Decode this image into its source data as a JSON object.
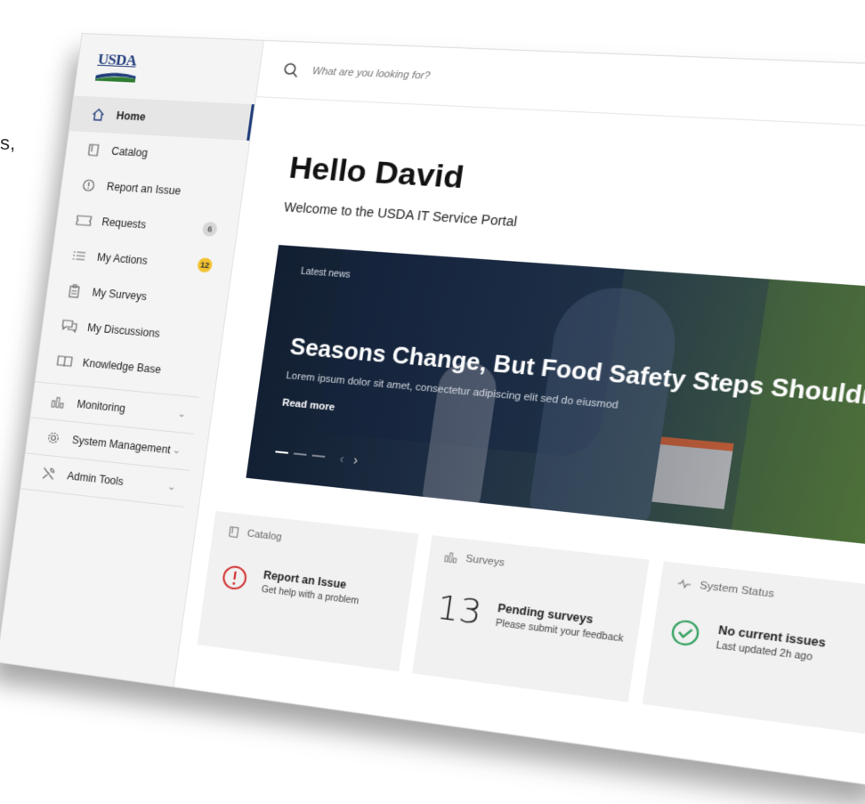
{
  "stray_text": "s,",
  "brand": {
    "logo_text": "USDA"
  },
  "search": {
    "placeholder": "What are you looking for?"
  },
  "sidebar": {
    "items": [
      {
        "label": "Home",
        "icon": "home-icon",
        "active": true
      },
      {
        "label": "Catalog",
        "icon": "book-icon"
      },
      {
        "label": "Report an Issue",
        "icon": "alert-circle-icon"
      },
      {
        "label": "Requests",
        "icon": "ticket-icon",
        "badge": "6"
      },
      {
        "label": "My Actions",
        "icon": "list-icon",
        "badge": "12"
      },
      {
        "label": "My Surveys",
        "icon": "clipboard-icon"
      },
      {
        "label": "My Discussions",
        "icon": "chat-icon"
      },
      {
        "label": "Knowledge Base",
        "icon": "open-book-icon"
      }
    ],
    "groups": [
      {
        "label": "Monitoring",
        "icon": "bar-chart-icon"
      },
      {
        "label": "System Management",
        "icon": "gear-icon"
      },
      {
        "label": "Admin Tools",
        "icon": "tools-icon"
      }
    ]
  },
  "greeting": {
    "title": "Hello David",
    "subtitle": "Welcome to the USDA IT Service Portal"
  },
  "hero": {
    "eyebrow": "Latest news",
    "headline": "Seasons Change, But Food Safety Steps Shouldn’t",
    "body": "Lorem ipsum dolor sit amet, consectetur adipiscing elit sed do eiusmod",
    "cta": "Read more",
    "slides": 3,
    "current_slide": 1
  },
  "cards": {
    "catalog": {
      "header": "Catalog",
      "title": "Report an Issue",
      "subtitle": "Get help with a problem"
    },
    "surveys": {
      "header": "Surveys",
      "count": "13",
      "title": "Pending surveys",
      "subtitle": "Please submit your feedback"
    },
    "status": {
      "header": "System Status",
      "title": "No current issues",
      "subtitle": "Last updated 2h ago"
    }
  },
  "colors": {
    "brand_blue": "#1f3c7a",
    "brand_green": "#2e7d32",
    "alert_red": "#d32f2f",
    "ok_green": "#2e9e5b",
    "badge_yellow": "#f2c230"
  }
}
